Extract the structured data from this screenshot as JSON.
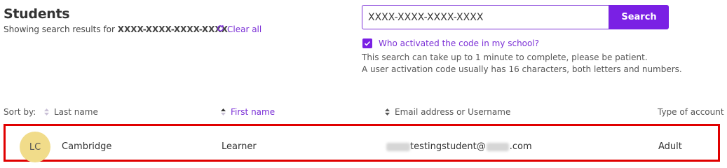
{
  "header": {
    "title": "Students",
    "results_prefix": "Showing search results for ",
    "query": "XXXX-XXXX-XXXX-XXXX",
    "results_suffix": ".",
    "clear_all_label": "Clear all"
  },
  "search": {
    "value": "XXXX-XXXX-XXXX-XXXX",
    "button_label": "Search",
    "checkbox_checked": true,
    "checkbox_label": "Who activated the code in my school?",
    "hint_1": "This search can take up to 1 minute to complete, please be patient.",
    "hint_2": "A user activation code usually has 16 characters, both letters and numbers."
  },
  "table": {
    "sort_label": "Sort by:",
    "columns": [
      {
        "label": "Last name",
        "active": false
      },
      {
        "label": "First name",
        "active": true
      },
      {
        "label": "Email address or Username",
        "active": false
      },
      {
        "label": "Type of account"
      }
    ],
    "rows": [
      {
        "initials": "LC",
        "last_name": "Cambridge",
        "first_name": "Learner",
        "email_visible_part": "testingstudent@",
        "email_domain_end": ".com",
        "account_type": "Adult"
      }
    ]
  },
  "colors": {
    "accent": "#7a20e4",
    "highlight_border": "#e00000",
    "avatar_bg": "#f1dc8a"
  },
  "icons": {
    "clear": "refresh-icon",
    "sort": "sort-arrows-icon",
    "checkbox": "check-icon"
  }
}
